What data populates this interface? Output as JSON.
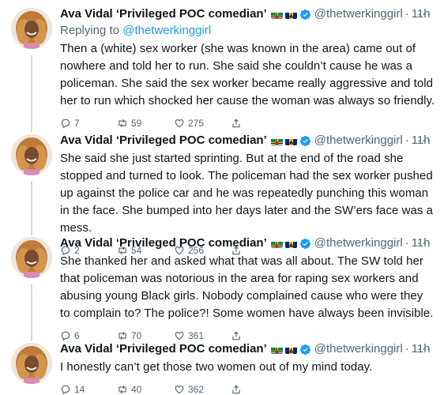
{
  "colors": {
    "accent": "#1d9bf0",
    "muted": "#536471",
    "text": "#0f1419",
    "thread_line": "#cfd9de"
  },
  "author": {
    "name": "Ava Vidal ‘Privileged POC comedian’",
    "handle": "@thetwerkinggirl",
    "separator": "·",
    "time": "11h",
    "flags": [
      "dominica-flag",
      "barbados-flag"
    ],
    "verified_icon": "verified-badge-icon",
    "more_label": "···"
  },
  "tweets": [
    {
      "reply_prefix": "Replying to",
      "reply_handle": "@thetwerkinggirl",
      "text": "Then a (white) sex worker (she was known in the area) came out of nowhere and told her to run. She said she couldn’t cause he was a policeman. She said the sex worker became really aggressive and told her to run which shocked her cause the woman was always so friendly.",
      "replies": "7",
      "retweets": "59",
      "likes": "275"
    },
    {
      "text": "She said she just started sprinting. But at the end of the road she stopped and turned to look. The policeman had the sex worker pushed up against the police car and he was repeatedly punching this woman in the face. She bumped into her days later and the SW’ers face was a mess.",
      "replies": "2",
      "retweets": "54",
      "likes": "256"
    },
    {
      "text": "She thanked her and asked what that was all about. The SW told her that policeman was notorious in the area for raping sex workers and abusing young Black girls. Nobody complained cause who were they to complain to? The police?! Some women have always been invisible.",
      "replies": "6",
      "retweets": "70",
      "likes": "361"
    },
    {
      "text": "I honestly can’t get those two women out of my mind today.",
      "replies": "14",
      "retweets": "40",
      "likes": "362"
    }
  ]
}
